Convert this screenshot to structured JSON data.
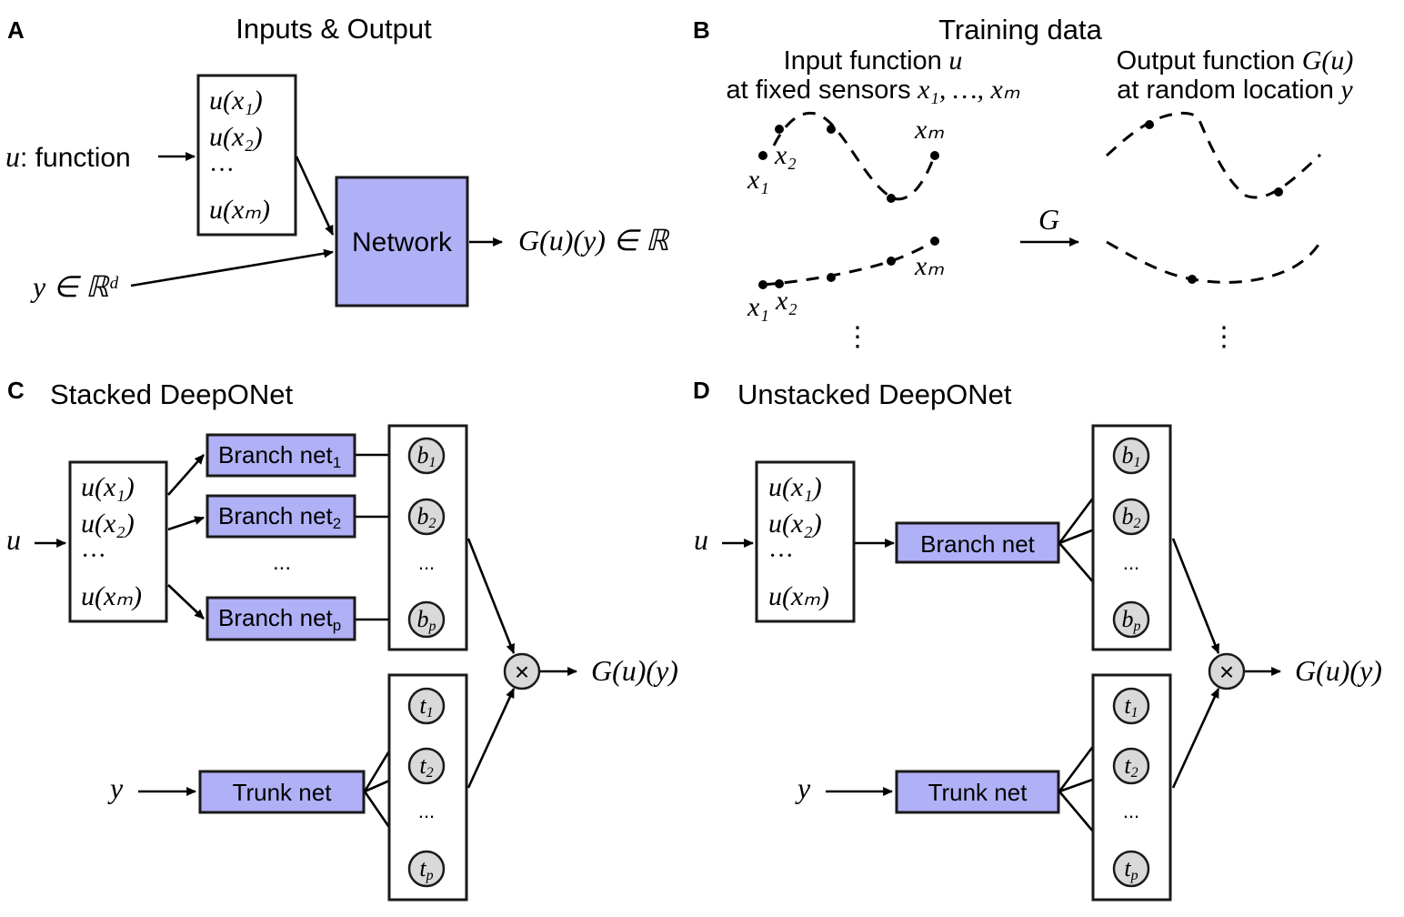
{
  "colors": {
    "network_fill": "#b0b0f7",
    "node_fill": "#d9d9d9",
    "stroke": "#1a1a1a"
  },
  "panelA": {
    "letter": "A",
    "title": "Inputs & Output",
    "input_label_var": "u",
    "input_label_text": ": function",
    "sensor_values": [
      "u(x₁)",
      "u(x₂)",
      "···",
      "u(xₘ)"
    ],
    "y_label": "y ∈ ℝᵈ",
    "network_label": "Network",
    "output_label": "G(u)(y) ∈ ℝ"
  },
  "panelB": {
    "letter": "B",
    "title": "Training data",
    "input_header_line1": "Input function",
    "input_header_var1": "u",
    "input_header_line2": "at fixed sensors",
    "input_header_var2": "x₁, …, xₘ",
    "output_header_line1": "Output function",
    "output_header_var1": "G(u)",
    "output_header_line2": "at random location",
    "output_header_var2": "y",
    "operator_label": "G",
    "sensor_labels": {
      "x1": "x₁",
      "x2": "x₂",
      "xm": "xₘ"
    },
    "continuation": "⋮"
  },
  "panelC": {
    "letter": "C",
    "title": "Stacked DeepONet",
    "input_var": "u",
    "sensor_values": [
      "u(x₁)",
      "u(x₂)",
      "···",
      "u(xₘ)"
    ],
    "branch_nets": [
      {
        "label": "Branch net",
        "sub": "1"
      },
      {
        "label": "Branch net",
        "sub": "2"
      },
      {
        "label": "Branch net",
        "sub": "p"
      }
    ],
    "branch_ellipsis": "...",
    "branch_nodes": [
      {
        "label": "b",
        "sub": "1"
      },
      {
        "label": "b",
        "sub": "2"
      },
      {
        "label": "b",
        "sub": "p"
      }
    ],
    "node_ellipsis": "...",
    "trunk_input": "y",
    "trunk_net": "Trunk net",
    "trunk_nodes": [
      {
        "label": "t",
        "sub": "1"
      },
      {
        "label": "t",
        "sub": "2"
      },
      {
        "label": "t",
        "sub": "p"
      }
    ],
    "product_symbol": "×",
    "output_label": "G(u)(y)"
  },
  "panelD": {
    "letter": "D",
    "title": "Unstacked DeepONet",
    "input_var": "u",
    "sensor_values": [
      "u(x₁)",
      "u(x₂)",
      "···",
      "u(xₘ)"
    ],
    "branch_net": "Branch net",
    "branch_nodes": [
      {
        "label": "b",
        "sub": "1"
      },
      {
        "label": "b",
        "sub": "2"
      },
      {
        "label": "b",
        "sub": "p"
      }
    ],
    "node_ellipsis": "...",
    "trunk_input": "y",
    "trunk_net": "Trunk net",
    "trunk_nodes": [
      {
        "label": "t",
        "sub": "1"
      },
      {
        "label": "t",
        "sub": "2"
      },
      {
        "label": "t",
        "sub": "p"
      }
    ],
    "product_symbol": "×",
    "output_label": "G(u)(y)"
  }
}
